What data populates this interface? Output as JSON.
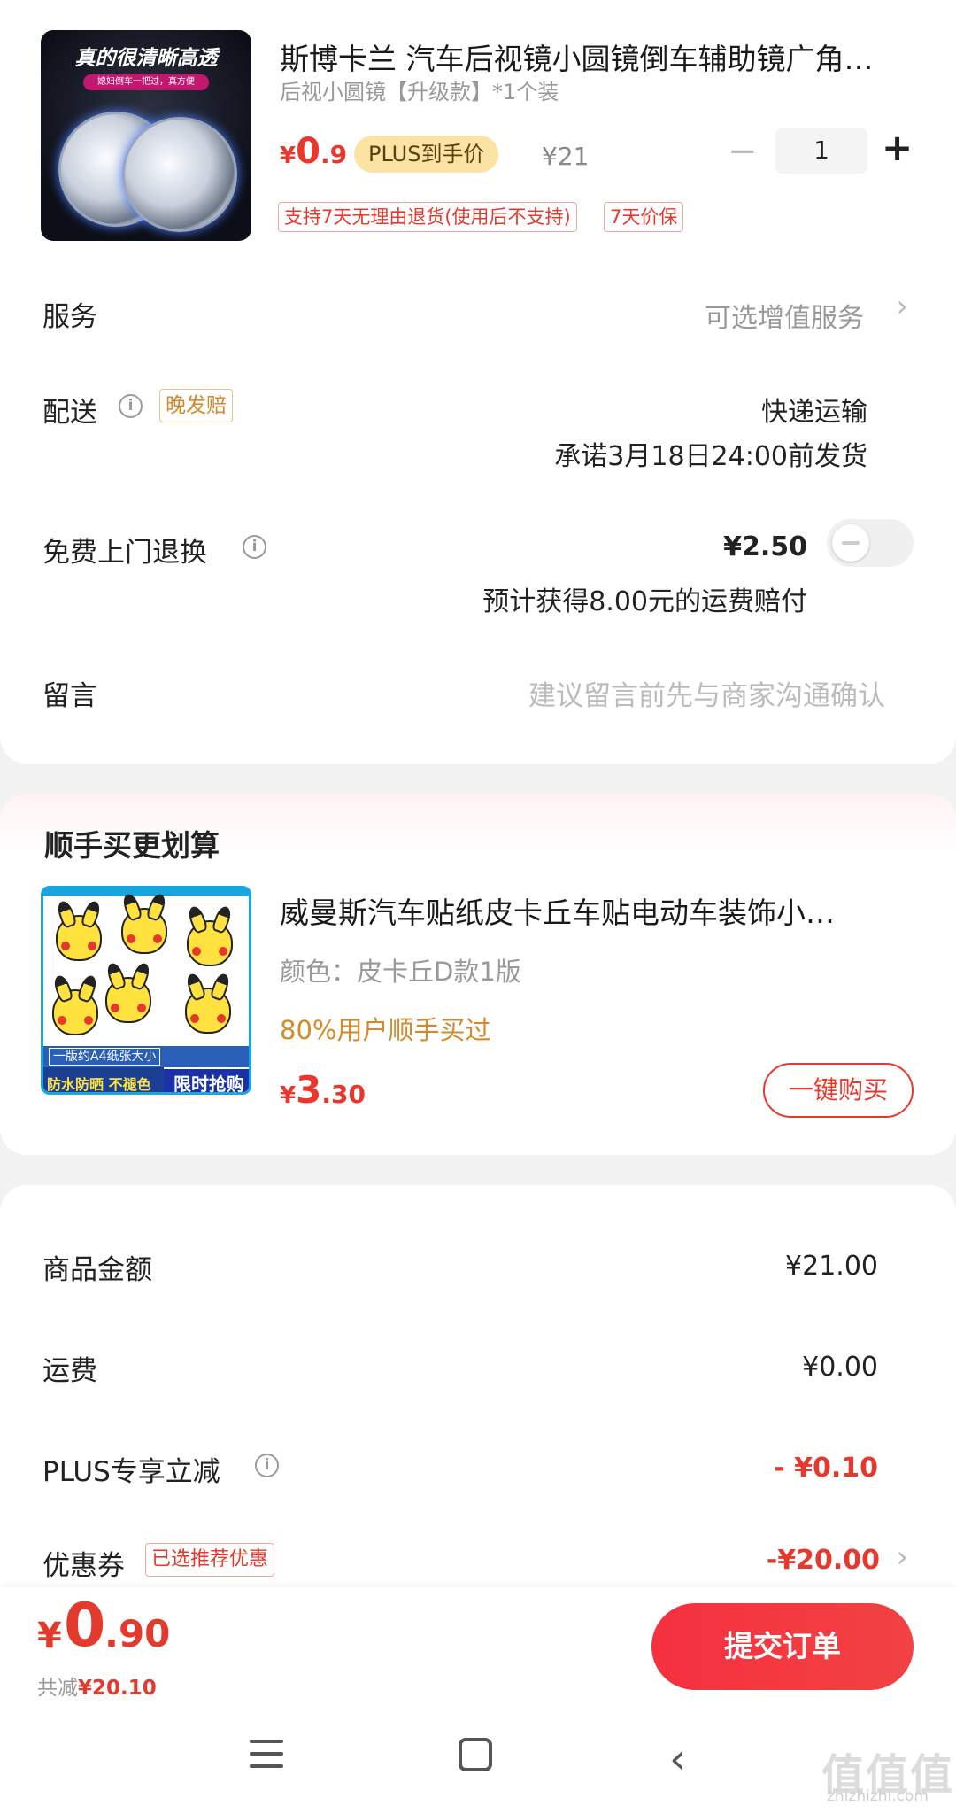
{
  "product": {
    "image_headline": "真的很清晰高透",
    "image_tagline": "媳妇倒车一把过，真方便",
    "title": "斯博卡兰 汽车后视镜小圆镜倒车辅助镜广角…",
    "sku": "后视小圆镜【升级款】*1个装",
    "price_symbol": "¥",
    "price_int": "0",
    "price_dec": ".9",
    "plus_tag": "PLUS到手价",
    "original_price": "¥21",
    "quantity": "1",
    "qty_minus": "−",
    "qty_plus": "+",
    "tags": [
      "支持7天无理由退货(使用后不支持)",
      "7天价保"
    ]
  },
  "service": {
    "label": "服务",
    "value": "可选增值服务",
    "chevron": "›"
  },
  "delivery": {
    "label": "配送",
    "info": "i",
    "badge": "晚发赔",
    "method": "快递运输",
    "promise": "承诺3月18日24:00前发货"
  },
  "return": {
    "label": "免费上门退换",
    "info": "i",
    "price": "¥2.50",
    "note": "预计获得8.00元的运费赔付",
    "enabled": false
  },
  "message": {
    "label": "留言",
    "placeholder": "建议留言前先与商家沟通确认"
  },
  "addon": {
    "section_title": "顺手买更划算",
    "image_text_1": "一版约A4纸张大小",
    "image_text_2": "防水防晒 不褪色",
    "image_text_3": "限时抢购",
    "title": "威曼斯汽车贴纸皮卡丘车贴电动车装饰小…",
    "sku": "颜色：皮卡丘D款1版",
    "social": "80%用户顺手买过",
    "price_symbol": "¥",
    "price_int": "3",
    "price_dec": ".30",
    "button": "一键购买"
  },
  "summary": {
    "goods_label": "商品金额",
    "goods_value": "¥21.00",
    "shipping_label": "运费",
    "shipping_value": "¥0.00",
    "plus_label": "PLUS专享立减",
    "plus_info": "i",
    "plus_value": "- ¥0.10",
    "coupon_label": "优惠券",
    "coupon_badge": "已选推荐优惠",
    "coupon_value": "-¥20.00",
    "chevron": "›"
  },
  "footer": {
    "total_symbol": "¥",
    "total_int": "0",
    "total_dec": ".90",
    "saved_label": "共减",
    "saved_value": "¥20.10",
    "submit": "提交订单"
  },
  "navbar": {
    "back": "‹"
  },
  "watermark": {
    "logo": "值值值",
    "url": "zhizhizhi.com"
  },
  "colors": {
    "accent": "#e4392d",
    "plus_tag_bg": "#fbe3a3",
    "orange": "#d58a2a",
    "submit_bg": "#f5303f"
  }
}
